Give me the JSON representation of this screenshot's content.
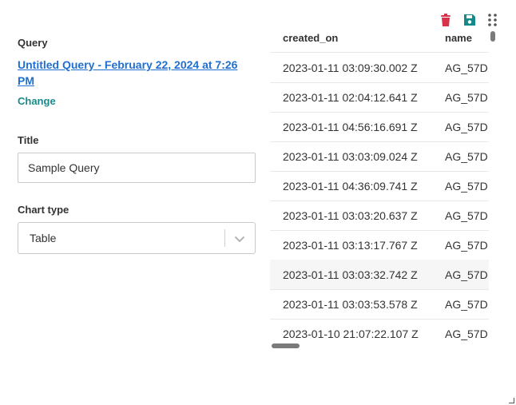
{
  "query": {
    "label": "Query",
    "name": "Untitled Query - February 22, 2024 at 7:26 PM",
    "change_label": "Change"
  },
  "title": {
    "label": "Title",
    "value": "Sample Query"
  },
  "chart_type": {
    "label": "Chart type",
    "selected": "Table"
  },
  "toolbar": {
    "icons": [
      "trash-icon",
      "save-icon",
      "drag-handle-icon"
    ],
    "colors": {
      "trash": "#d6324a",
      "save": "#148a8a",
      "drag": "#555555"
    }
  },
  "table": {
    "columns": [
      "created_on",
      "name"
    ],
    "rows": [
      [
        "2023-01-11 03:09:30.002 Z",
        "AG_57D"
      ],
      [
        "2023-01-11 02:04:12.641 Z",
        "AG_57D"
      ],
      [
        "2023-01-11 04:56:16.691 Z",
        "AG_57D"
      ],
      [
        "2023-01-11 03:03:09.024 Z",
        "AG_57D"
      ],
      [
        "2023-01-11 04:36:09.741 Z",
        "AG_57D"
      ],
      [
        "2023-01-11 03:03:20.637 Z",
        "AG_57D"
      ],
      [
        "2023-01-11 03:13:17.767 Z",
        "AG_57D"
      ],
      [
        "2023-01-11 03:03:32.742 Z",
        "AG_57D"
      ],
      [
        "2023-01-11 03:03:53.578 Z",
        "AG_57D"
      ],
      [
        "2023-01-10 21:07:22.107 Z",
        "AG_57D"
      ]
    ]
  }
}
